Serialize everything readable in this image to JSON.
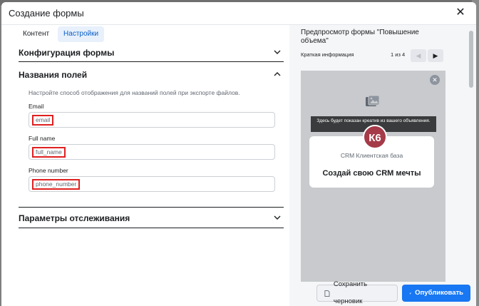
{
  "modal": {
    "title": "Создание формы",
    "close_icon": "close-icon"
  },
  "tabs": [
    {
      "label": "Контент",
      "active": false
    },
    {
      "label": "Настройки",
      "active": true
    }
  ],
  "sections": {
    "form_config": "Конфигурация формы",
    "field_names": "Названия полей",
    "field_names_hint": "Настройте способ отображения для названий полей при экспорте файлов.",
    "tracking": "Параметры отслеживания"
  },
  "fields": [
    {
      "label": "Email",
      "value": "email"
    },
    {
      "label": "Full name",
      "value": "full_name"
    },
    {
      "label": "Phone number",
      "value": "phone_number"
    }
  ],
  "preview": {
    "title": "Предпросмотр формы \"Повышение объема\"",
    "nav_label": "Краткая информация",
    "page_count": "1 из 4",
    "banner": "Здесь будет показан креатив из вашего объявления.",
    "avatar_text": "К6",
    "card_subtitle": "CRM Клиентская база",
    "card_heading": "Создай свою CRM мечты"
  },
  "footer": {
    "save_draft": "Сохранить черновик",
    "publish": "Опубликовать"
  },
  "colors": {
    "accent": "#1877f2",
    "highlight_border": "#e02020",
    "avatar_bg": "#a53a48"
  }
}
